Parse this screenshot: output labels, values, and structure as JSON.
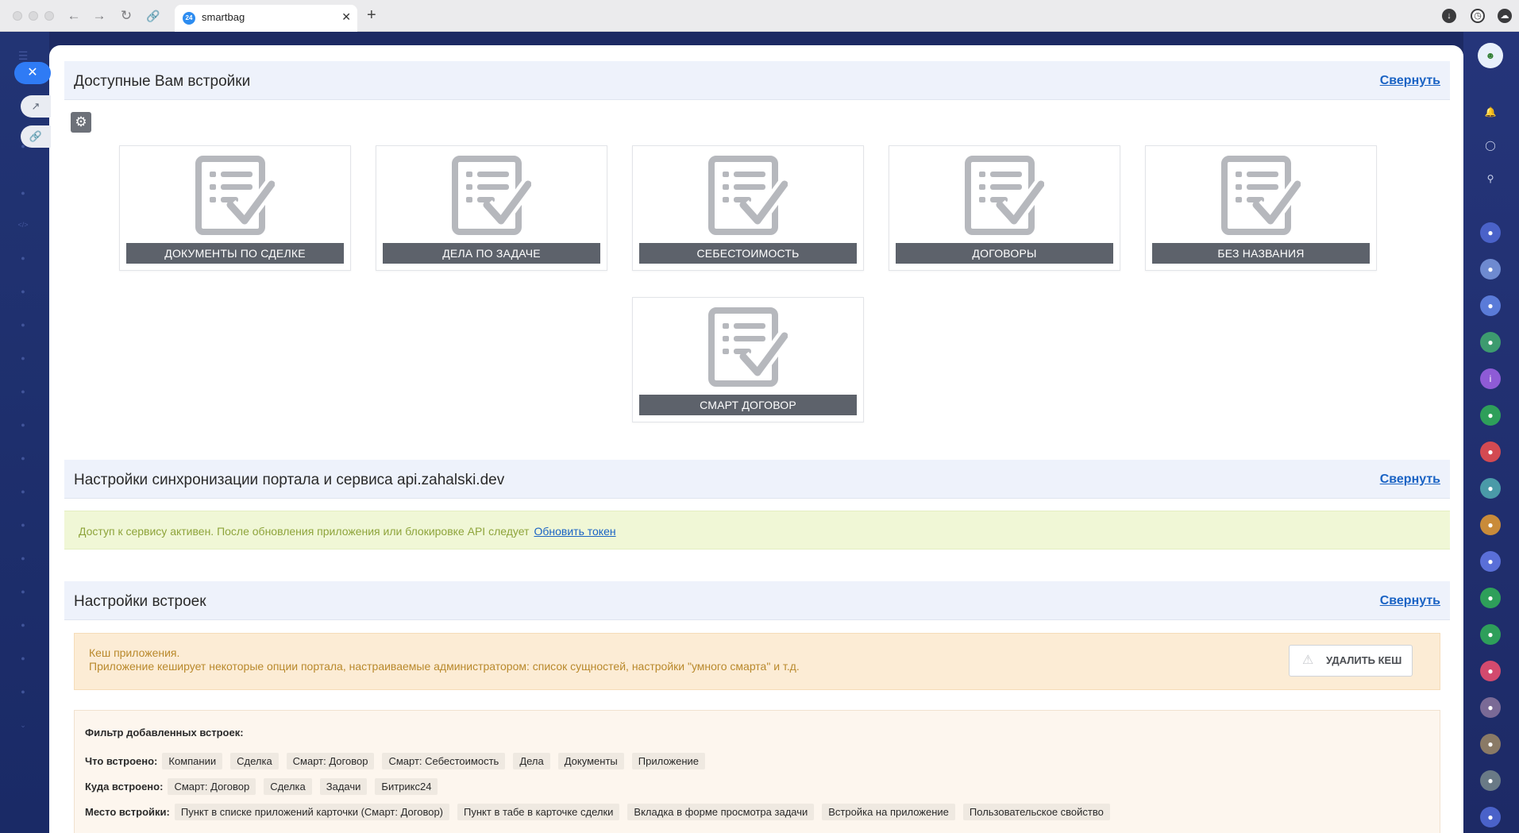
{
  "browser": {
    "tab_title": "smartbag",
    "tab_favicon": "24",
    "icons": [
      "traffic-close",
      "traffic-minimize",
      "traffic-zoom",
      "back-arrow",
      "forward-arrow",
      "reload",
      "link",
      "download",
      "history",
      "cloud"
    ]
  },
  "sections": {
    "embeds": {
      "title": "Доступные Вам встройки",
      "toggle": "Свернуть"
    },
    "sync": {
      "title": "Настройки синхронизации портала и сервиса api.zahalski.dev",
      "toggle": "Свернуть"
    },
    "settings": {
      "title": "Настройки встроек",
      "toggle": "Свернуть"
    }
  },
  "cards": [
    {
      "label": "ДОКУМЕНТЫ ПО СДЕЛКЕ"
    },
    {
      "label": "ДЕЛА ПО ЗАДАЧЕ"
    },
    {
      "label": "СЕБЕСТОИМОСТЬ"
    },
    {
      "label": "ДОГОВОРЫ"
    },
    {
      "label": "БЕЗ НАЗВАНИЯ"
    },
    {
      "label": "СМАРТ ДОГОВОР"
    }
  ],
  "sync_alert": {
    "text": "Доступ к сервису активен. После обновления приложения или блокировке API следует",
    "link": "Обновить токен"
  },
  "cache": {
    "line1": "Кеш приложения.",
    "line2": "Приложение кеширует некоторые опции портала, настраиваемые администратором: список сущностей, настройки \"умного смарта\" и т.д.",
    "button": "УДАЛИТЬ КЕШ"
  },
  "filter": {
    "title": "Фильтр добавленных встроек:",
    "rows": [
      {
        "label": "Что встроено:",
        "chips": [
          "Компании",
          "Сделка",
          "Смарт: Договор",
          "Смарт: Себестоимость",
          "Дела",
          "Документы",
          "Приложение"
        ]
      },
      {
        "label": "Куда встроено:",
        "chips": [
          "Смарт: Договор",
          "Сделка",
          "Задачи",
          "Битрикс24"
        ]
      },
      {
        "label": "Место встройки:",
        "chips": [
          "Пункт в списке приложений карточки (Смарт: Договор)",
          "Пункт в табе в карточке сделки",
          "Вкладка в форме просмотра задачи",
          "Встройка на приложение",
          "Пользовательское свойство"
        ]
      }
    ]
  },
  "colors": {
    "accent_link": "#1a63c4",
    "card_label_bg": "#5d626b",
    "sync_bg": "#f0f7d6",
    "cache_bg": "#fcecd5",
    "rail_bg": "#1d2a63"
  }
}
